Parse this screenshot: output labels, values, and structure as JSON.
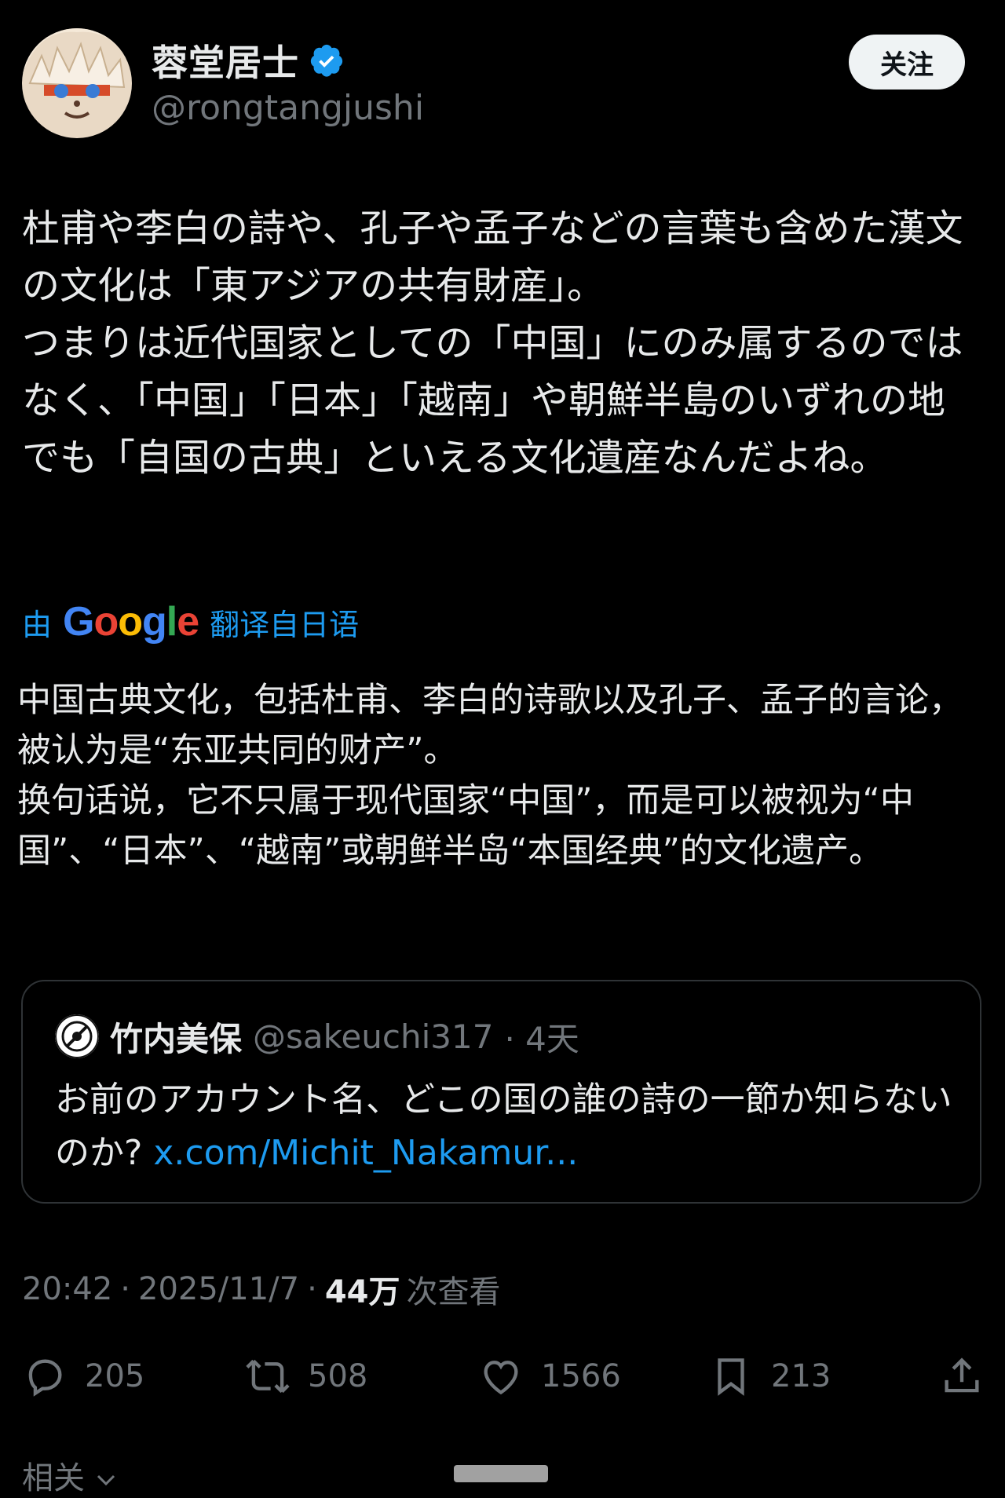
{
  "author": {
    "display_name": "蓉堂居士",
    "handle": "@rongtangjushi"
  },
  "follow_label": "关注",
  "post": {
    "original_text": "杜甫や李白の詩や、孔子や孟子などの言葉も含めた漢文の文化は「東アジアの共有財産」。\nつまりは近代国家としての「中国」にのみ属するのではなく、「中国」「日本」「越南」や朝鮮半島のいずれの地でも「自国の古典」といえる文化遺産なんだよね。",
    "translate_prefix": "由",
    "translate_brand": "Google",
    "translate_suffix": "翻译自日语",
    "translated_text": "中国古典文化，包括杜甫、李白的诗歌以及孔子、孟子的言论，被认为是“东亚共同的财产”。\n换句话说，它不只属于现代国家“中国”，而是可以被视为“中国”、“日本”、“越南”或朝鲜半岛“本国经典”的文化遗产。"
  },
  "quote": {
    "display_name": "竹内美保",
    "handle": "@sakeuchi317",
    "time": "· 4天",
    "text": "お前のアカウント名、どこの国の誰の詩の一節か知らないのか?",
    "link": "x.com/Michit_Nakamur..."
  },
  "meta": {
    "time": "20:42",
    "date": "2025/11/7",
    "views": "44万",
    "views_label": "次查看",
    "sep": "·"
  },
  "actions": {
    "replies": "205",
    "reposts": "508",
    "likes": "1566",
    "bookmarks": "213"
  },
  "related_label": "相关",
  "colors": {
    "background": "#000000",
    "text": "#e7e9ea",
    "muted": "#71767b",
    "accent": "#1d9bf0",
    "verified": "#1d9bf0"
  }
}
